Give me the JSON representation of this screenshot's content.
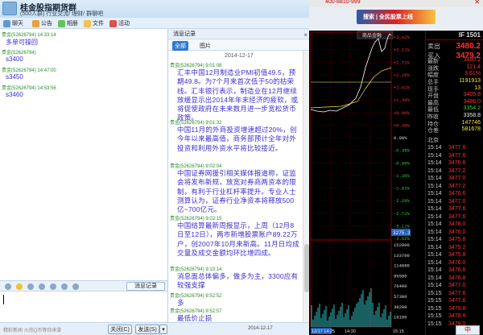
{
  "qq": {
    "group_name": "桂金股指期货群",
    "group_sub": "(500人群) 行业交流/ 理财/ 群聊吧",
    "toolbar": [
      "聊天",
      "公告",
      "相册",
      "文件",
      "活动"
    ],
    "chat_messages": [
      {
        "user": "贵金(52626794)",
        "time": "14:33:14",
        "text": "多单可操回"
      },
      {
        "user": "贵金(52626794)",
        "time": "",
        "text": "s3400"
      },
      {
        "user": "贵金(52626794)",
        "time": "14:47:00",
        "text": "s3450"
      },
      {
        "user": "贵金(52626794)",
        "time": "14:53:56",
        "text": "s3460"
      }
    ],
    "history_btn": "消息记录",
    "ad_text": "精彩新闻 火热Q币等你来拿",
    "close_btn": "关闭(C)",
    "send_btn": "发送(S)",
    "date_footer": "2014-12-17"
  },
  "history": {
    "title": "消息记录",
    "close": "×",
    "tabs": [
      "全部",
      "图片"
    ],
    "date": "2014-12-17",
    "messages": [
      {
        "head": "贵金(52626794) 9:01:08",
        "text": "汇丰中国12月制造业PMI初值49.5，预期49.8。为7个月来首次低于50的枯荣线。汇丰银行表示，制造业在12月继续放缓显示出2014年年末经济的疲软，或将促使政府在未来数月进一步宽松货币政策。"
      },
      {
        "head": "贵金(52626794) 9:01:32",
        "text": "中国11月的外商投资增速超过20%，创今年以来最高值，商务部预计全年对外投资和利用外资水平将比较接近。"
      },
      {
        "head": "贵金(52626794) 9:02:04",
        "text": "中国证券网援引相关媒体报道称，证监会将发布新规，放宽对券商两资本的限制，有利于行业杠杆率提升。专业人士测算认为，证券行业净资本将释放500亿~700亿元。"
      },
      {
        "head": "贵金(52626794) 9:02:15",
        "text": "中国结算最新周报显示，上周（12月8日至12日），两市新增股票账户89.22万户，创2007年10月来新高。11月日均成交量及成交金额均环比增四成。"
      },
      {
        "head": "贵金(52626794) 9:10:14",
        "text": "消息面总体偏多，做多为主，3300应有较强支撑"
      },
      {
        "head": "贵金(52626794) 9:52:52",
        "text": "多"
      },
      {
        "head": "贵金(52626794) 9:52:57",
        "text": "最低价止损"
      }
    ]
  },
  "stock": {
    "phone": "400-8810-999",
    "ad": "搜索 | 全民股票上线",
    "contract": "IF 1501",
    "chart_label": "商品金融",
    "pct_labels": [
      "+3.62%",
      "+3.11%",
      "+2.71%",
      "+2.26%",
      "+1.81%",
      "+1.36%",
      "+0.90%",
      "+0.45%",
      "0.00%",
      "-0.45%",
      "-0.90%",
      "-1.36%",
      "-1.81%",
      "-2.26%",
      "-2.71%",
      "-3.11%",
      "-3.62%"
    ],
    "price_marker": "3275.3",
    "vol_labels": [
      "152800",
      "133700",
      "114600",
      "95500",
      "76400",
      "57300",
      "38200",
      "19100"
    ],
    "time_labels": [
      "12/17 14:25",
      "14:30",
      "15:15"
    ],
    "quote": [
      {
        "label": "卖出",
        "value": "3480.2",
        "cls": "red"
      },
      {
        "label": "买入",
        "value": "3479.2",
        "cls": "red"
      },
      {
        "label": "最新",
        "value": "3480.2",
        "cls": "red"
      },
      {
        "label": "涨跌",
        "value": "121.4",
        "cls": "red"
      },
      {
        "label": "幅度",
        "value": "3.61%",
        "cls": "red"
      },
      {
        "label": "总手",
        "value": "1191913",
        "cls": "yel"
      },
      {
        "label": "现手",
        "value": "13",
        "cls": "yel"
      },
      {
        "label": "开盘",
        "value": "3405.8",
        "cls": "red"
      },
      {
        "label": "最高",
        "value": "3486.0",
        "cls": "red"
      },
      {
        "label": "最低",
        "value": "3354.2",
        "cls": "grn"
      },
      {
        "label": "昨收",
        "value": "3358.8",
        "cls": "wht"
      },
      {
        "label": "持仓",
        "value": "147746",
        "cls": "yel"
      },
      {
        "label": "仓差",
        "value": "581678",
        "cls": "yel"
      }
    ],
    "tick_header": "北京",
    "ticks": [
      {
        "t": "15:14",
        "p": "3477.6"
      },
      {
        "t": "15:14",
        "p": "3477.6"
      },
      {
        "t": "15:14",
        "p": "3476.6"
      },
      {
        "t": "15:14",
        "p": "3477.2"
      },
      {
        "t": "15:14",
        "p": "3477.0"
      },
      {
        "t": "15:14",
        "p": "3477.2"
      },
      {
        "t": "15:14",
        "p": "3476.6"
      },
      {
        "t": "15:14",
        "p": "3477.0"
      },
      {
        "t": "15:14",
        "p": "3477.6"
      },
      {
        "t": "15:14",
        "p": "3477.6"
      },
      {
        "t": "15:14",
        "p": "3478.0"
      },
      {
        "t": "15:14",
        "p": "3476.0"
      },
      {
        "t": "15:14",
        "p": "3475.8"
      },
      {
        "t": "15:14",
        "p": "3475.2"
      },
      {
        "t": "15:14",
        "p": "3475.8"
      },
      {
        "t": "15:14",
        "p": "3476.0"
      },
      {
        "t": "15:14",
        "p": "3476.6"
      },
      {
        "t": "15:14",
        "p": "3476.8"
      },
      {
        "t": "15:14",
        "p": "3477.0"
      },
      {
        "t": "15:15",
        "p": "3477.6"
      },
      {
        "t": "15:15",
        "p": "3477.6"
      },
      {
        "t": "15:15",
        "p": "3479.8"
      },
      {
        "t": "15:15",
        "p": "3478.8"
      },
      {
        "t": "15:15",
        "p": "3479.0"
      }
    ],
    "taskbar_text": "中"
  }
}
